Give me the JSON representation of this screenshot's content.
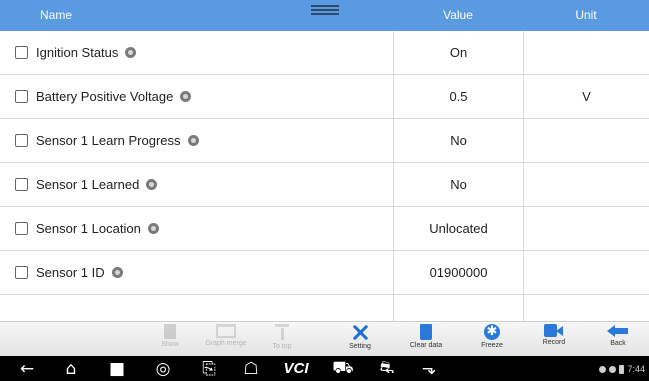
{
  "table": {
    "headers": {
      "name": "Name",
      "value": "Value",
      "unit": "Unit"
    },
    "rows": [
      {
        "name": "Ignition Status",
        "value": "On",
        "unit": ""
      },
      {
        "name": "Battery Positive Voltage",
        "value": "0.5",
        "unit": "V"
      },
      {
        "name": "Sensor 1 Learn Progress",
        "value": "No",
        "unit": ""
      },
      {
        "name": "Sensor 1 Learned",
        "value": "No",
        "unit": ""
      },
      {
        "name": "Sensor 1 Location",
        "value": "Unlocated",
        "unit": ""
      },
      {
        "name": "Sensor 1 ID",
        "value": "01900000",
        "unit": ""
      }
    ]
  },
  "toolbar": {
    "show_label": "Show",
    "graph_label": "Graph merge",
    "top_label": "To top",
    "setting_label": "Setting",
    "clear_label": "Clear data",
    "freeze_label": "Freeze",
    "record_label": "Record",
    "back_label": "Back"
  },
  "sysbar": {
    "vci_text": "VCI",
    "time": "7:44"
  },
  "colors": {
    "header_bg": "#5a9ae0",
    "accent_icon": "#2a79da",
    "system_bar": "#000000"
  },
  "icons": [
    "drag-handle-icon",
    "info-icon",
    "show-icon",
    "graph-merge-icon",
    "to-top-icon",
    "setting-icon",
    "clear-data-icon",
    "freeze-icon",
    "record-icon",
    "back-icon",
    "nav-back-icon",
    "home-icon",
    "recent-apps-icon",
    "chrome-icon",
    "screen-cast-icon",
    "house-icon",
    "car-icon",
    "car-service-icon",
    "usb-icon"
  ]
}
